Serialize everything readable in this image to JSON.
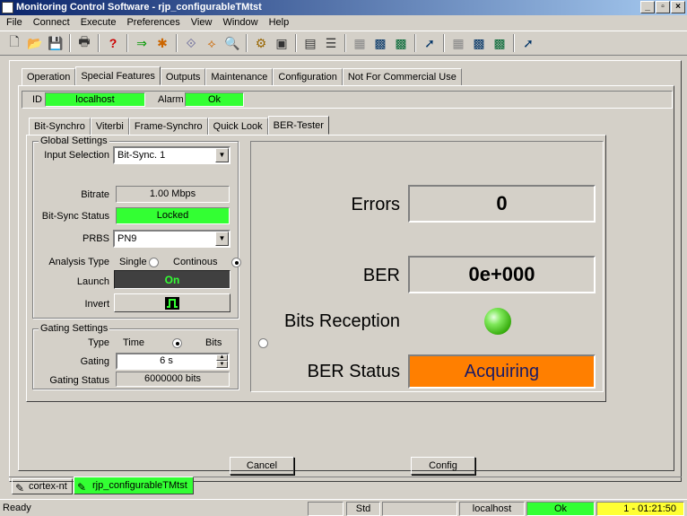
{
  "window": {
    "title": "Monitoring Control Software - rjp_configurableTMtst",
    "controls": [
      "_",
      "▫",
      "×"
    ]
  },
  "menu": [
    "File",
    "Connect",
    "Execute",
    "Preferences",
    "View",
    "Window",
    "Help"
  ],
  "toolbar_icons": [
    "new-file-icon",
    "open-folder-icon",
    "save-icon",
    "print-icon",
    "help-icon",
    "connect-icon",
    "execute-icon",
    "link-icon",
    "unlink-icon",
    "zoom-icon",
    "settings-icon",
    "panel-icon",
    "monitor-icon",
    "list-icon",
    "grid-icon",
    "chart-icon",
    "chart-alt-icon",
    "signal-icon",
    "grid-alt-icon",
    "chart-3-icon",
    "signal-alt-icon"
  ],
  "main_tabs": [
    "Operation",
    "Special Features",
    "Outputs",
    "Maintenance",
    "Configuration",
    "Not For Commercial Use"
  ],
  "id_label": "ID",
  "id_value": "localhost",
  "alarm_label": "Alarm",
  "alarm_value": "Ok",
  "sub_tabs": [
    "Bit-Synchro",
    "Viterbi",
    "Frame-Synchro",
    "Quick Look",
    "BER-Tester"
  ],
  "global_settings": {
    "title": "Global Settings",
    "input_selection_label": "Input Selection",
    "input_selection_value": "Bit-Sync. 1",
    "bitrate_label": "Bitrate",
    "bitrate_value": "1.00 Mbps",
    "bitsync_status_label": "Bit-Sync Status",
    "bitsync_status_value": "Locked",
    "prbs_label": "PRBS",
    "prbs_value": "PN9",
    "analysis_type_label": "Analysis Type",
    "single_label": "Single",
    "continous_label": "Continous",
    "launch_label": "Launch",
    "launch_value": "On",
    "invert_label": "Invert"
  },
  "gating_settings": {
    "title": "Gating Settings",
    "type_label": "Type",
    "time_label": "Time",
    "bits_label": "Bits",
    "gating_label": "Gating",
    "gating_value": "6 s",
    "gating_status_label": "Gating Status",
    "gating_status_value": "6000000 bits"
  },
  "ber_panel": {
    "errors_label": "Errors",
    "errors_value": "0",
    "ber_label": "BER",
    "ber_value": "0e+000",
    "bits_reception_label": "Bits Reception",
    "ber_status_label": "BER Status",
    "ber_status_value": "Acquiring"
  },
  "buttons": {
    "cancel": "Cancel",
    "config": "Config"
  },
  "doc_tabs": [
    "cortex-nt",
    "rjp_configurableTMtst"
  ],
  "statusbar": {
    "ready": "Ready",
    "std": "Std",
    "host": "localhost",
    "status": "Ok",
    "time": "1 - 01:21:50"
  },
  "colors": {
    "green": "#33ff33",
    "orange": "#ff7f00",
    "yellow": "#ffff33",
    "title_blue": "#0a246a"
  }
}
